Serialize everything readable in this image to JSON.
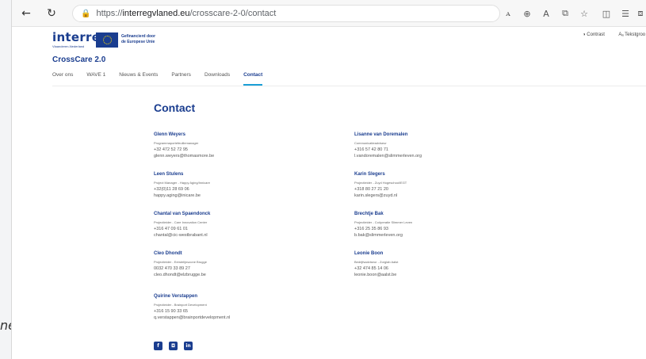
{
  "desktop": {
    "fragment": "ne"
  },
  "browser": {
    "back_icon": "arrow-left-icon",
    "refresh_icon": "refresh-icon",
    "url_protocol": "https://",
    "url_host": "interregvlaned.eu",
    "url_path": "/crosscare-2-0/contact",
    "toolbar_icons": [
      "translate-icon",
      "zoom-icon",
      "read-aloud-icon",
      "split-screen-icon",
      "favorite-icon",
      "sidebar-icon",
      "favorites-icon",
      "collections-icon"
    ]
  },
  "header": {
    "logo_word": "interreg",
    "logo_sub": "Vlaanderen-Nederland",
    "eu_line1": "Gefinancierd door",
    "eu_line2": "de Europese Unie",
    "contrast_label": "Contrast",
    "text_size_label": "Tekstgroo"
  },
  "site_title": "CrossCare 2.0",
  "nav": [
    "Over ons",
    "WAVE 1",
    "Nieuws & Events",
    "Partners",
    "Downloads",
    "Contact"
  ],
  "nav_active": "Contact",
  "heading": "Contact",
  "contacts": [
    {
      "name": "Glenn Weyers",
      "role": "Programmaportefeuillemanager",
      "phone": "+32 472 52 72 95",
      "email": "glenn.weyers@thomasmore.be"
    },
    {
      "name": "Lisanne van Doremalen",
      "role": "Communicatieadviseur",
      "phone": "+316 57 42 80 71",
      "email": "l.vandoremalen@slimmerleven.org"
    },
    {
      "name": "Leen Stulens",
      "role": "Project Manager - Happy Aging/Innicare",
      "phone": "+32(0)11 28 69 06",
      "email": "happy.aging@inicare.be"
    },
    {
      "name": "Karin Slegers",
      "role": "Projectleider - Zuyd Hogeschool/EGT",
      "phone": "+318 80 27 21 20",
      "email": "karin.slegers@zuyd.nl"
    },
    {
      "name": "Chantal van Spaendonck",
      "role": "Projectleider - Care Innovation Center",
      "phone": "+316 47 09 61 01",
      "email": "chantal@cic-westbrabant.nl"
    },
    {
      "name": "Brechtje Bak",
      "role": "Projectleider - Coöperatie Slimmer Leven",
      "phone": "+316 25 35 86 93",
      "email": "b.bak@slimmerleven.org"
    },
    {
      "name": "Cleo Dhondt",
      "role": "Projectleider - Eerstelijnszone Brugge",
      "phone": "0032 470 33 89 27",
      "email": "cleo.dhondt@elzbrugge.be"
    },
    {
      "name": "Leonie Boon",
      "role": "Bedrijfsadviseur - Zorglab Aalst",
      "phone": "+32 474 85 14 06",
      "email": "leonie.boon@aalst.be"
    },
    {
      "name": "Quirine Verstappen",
      "role": "Projectleider - Brainport Development",
      "phone": "+316 15 90 33 65",
      "email": "q.verstappen@brainportdevelopment.nl"
    }
  ],
  "social": [
    {
      "name": "facebook-icon",
      "glyph": "f"
    },
    {
      "name": "instagram-icon",
      "glyph": "◘"
    },
    {
      "name": "linkedin-icon",
      "glyph": "in"
    }
  ],
  "colors": {
    "brand": "#1a3d8f",
    "accent": "#1a9fd6"
  }
}
